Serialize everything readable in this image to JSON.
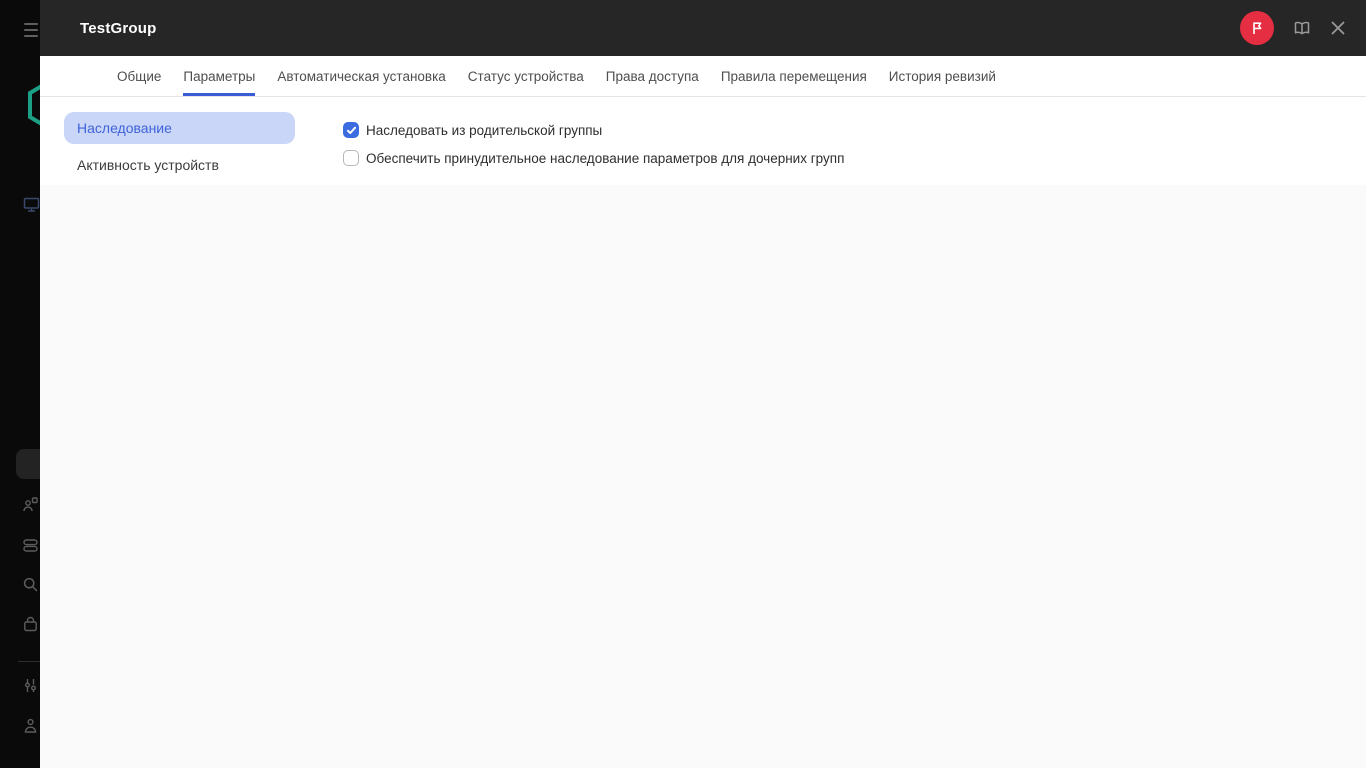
{
  "colors": {
    "accent_blue": "#3a5cd6",
    "checkbox_blue": "#3b6ce0",
    "pill_bg": "#cad6f8",
    "pill_text": "#3e63da",
    "header_bg": "#262626",
    "sidebar_bg": "#0a0a0a",
    "badge_red": "#e62e43",
    "logo_teal": "#1b9f85"
  },
  "header": {
    "title": "TestGroup",
    "icons": [
      "flag-badge-icon",
      "book-icon",
      "close-icon"
    ]
  },
  "tabs": {
    "items": [
      "Общие",
      "Параметры",
      "Автоматическая установка",
      "Статус устройства",
      "Права доступа",
      "Правила перемещения",
      "История ревизий"
    ],
    "active": "Параметры"
  },
  "subnav": {
    "items": [
      {
        "label": "Наследование",
        "selected": true
      },
      {
        "label": "Активность устройств",
        "selected": false
      }
    ]
  },
  "settings": {
    "checkboxes": [
      {
        "label": "Наследовать из родительской группы",
        "checked": true
      },
      {
        "label": "Обеспечить принудительное наследование параметров для дочерних групп",
        "checked": false
      }
    ]
  },
  "sidebar": {
    "icons": [
      "hamburger-menu-icon",
      "hexagon-logo-icon",
      "monitor-icon",
      "users-icon",
      "server-icon",
      "search-icon",
      "bag-icon",
      "sliders-icon",
      "account-icon"
    ]
  }
}
